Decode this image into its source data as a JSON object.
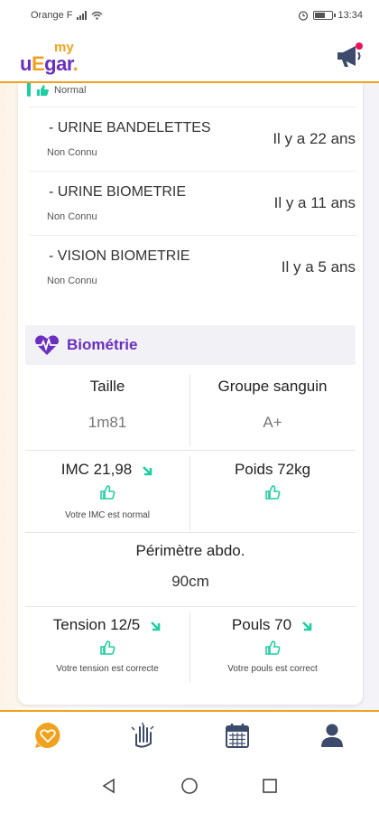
{
  "status_bar": {
    "carrier": "Orange F",
    "time": "13:34"
  },
  "header": {
    "logo_my": "my",
    "logo_u": "u",
    "logo_e": "E",
    "logo_rest": "gar",
    "logo_dot": "."
  },
  "cut_item": {
    "status": "Normal"
  },
  "exams": [
    {
      "name": "- URINE BANDELETTES",
      "status": "Non Connu",
      "date": "Il y a 22 ans"
    },
    {
      "name": "- URINE BIOMETRIE",
      "status": "Non Connu",
      "date": "Il y a 11 ans"
    },
    {
      "name": "- VISION BIOMETRIE",
      "status": "Non Connu",
      "date": "Il y a 5 ans"
    }
  ],
  "biometrie": {
    "title": "Biométrie",
    "taille_label": "Taille",
    "taille_value": "1m81",
    "groupe_label": "Groupe sanguin",
    "groupe_value": "A+",
    "imc_label": "IMC 21,98",
    "imc_note": "Votre IMC est normal",
    "poids_label": "Poids 72kg",
    "perimetre_label": "Périmètre abdo.",
    "perimetre_value": "90cm",
    "tension_label": "Tension 12/5",
    "tension_note": "Votre tension est correcte",
    "pouls_label": "Pouls 70",
    "pouls_note": "Votre pouls est correct"
  },
  "icons": {
    "nav": [
      "heart-chat-icon",
      "hand-icon",
      "calendar-icon",
      "user-icon"
    ],
    "thumb": "thumbs-up-icon",
    "arrow": "arrow-down-right-icon"
  },
  "colors": {
    "accent_orange": "#f0a21e",
    "brand_purple": "#6a2fc0",
    "teal": "#1fcfa3",
    "nav_blue": "#3c4a6b"
  }
}
